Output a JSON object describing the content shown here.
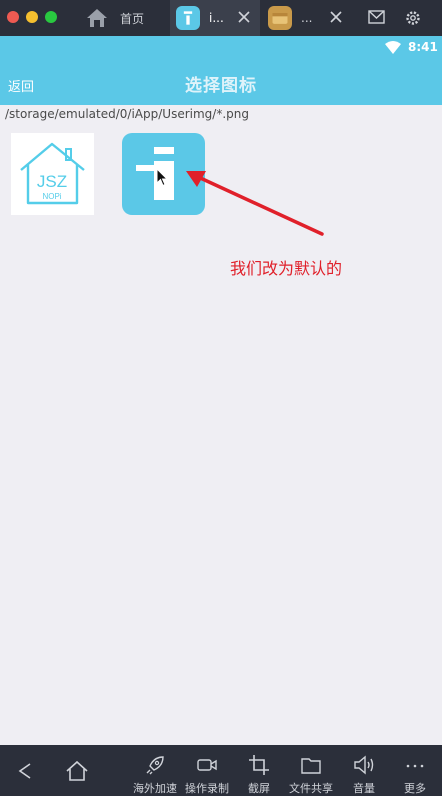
{
  "tabs": {
    "home_label": "首页",
    "active_label": "i...",
    "third_label": "..."
  },
  "statusbar": {
    "time": "8:41"
  },
  "appbar": {
    "back_label": "返回",
    "title": "选择图标"
  },
  "main": {
    "path": "/storage/emulated/0/iApp/Userimg/*.png",
    "image1_logo_text": [
      "JSZ",
      "NOPi"
    ],
    "annotation": "我们改为默认的"
  },
  "toolbar": {
    "items": [
      {
        "label": "海外加速",
        "icon": "rocket-icon"
      },
      {
        "label": "操作录制",
        "icon": "video-icon"
      },
      {
        "label": "截屏",
        "icon": "crop-icon"
      },
      {
        "label": "文件共享",
        "icon": "folder-icon"
      },
      {
        "label": "音量",
        "icon": "volume-icon"
      },
      {
        "label": "更多",
        "icon": "more-icon"
      }
    ]
  },
  "colors": {
    "accent": "#5bc8e7",
    "annotation": "#e0202a",
    "chrome": "#2b2f3a"
  }
}
